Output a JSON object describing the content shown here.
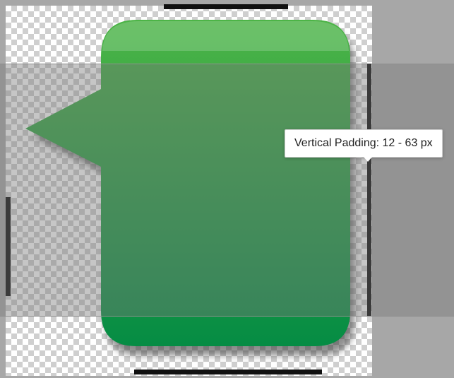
{
  "editor": {
    "tooltip_text": "Vertical Padding: 12 - 63 px"
  },
  "icons": {
    "bubble": "speech-bubble-icon"
  },
  "colors": {
    "bubble_top": "#4db447",
    "bubble_bottom": "#058c44",
    "overlay": "#7a7a7a",
    "guide": "#111111"
  }
}
